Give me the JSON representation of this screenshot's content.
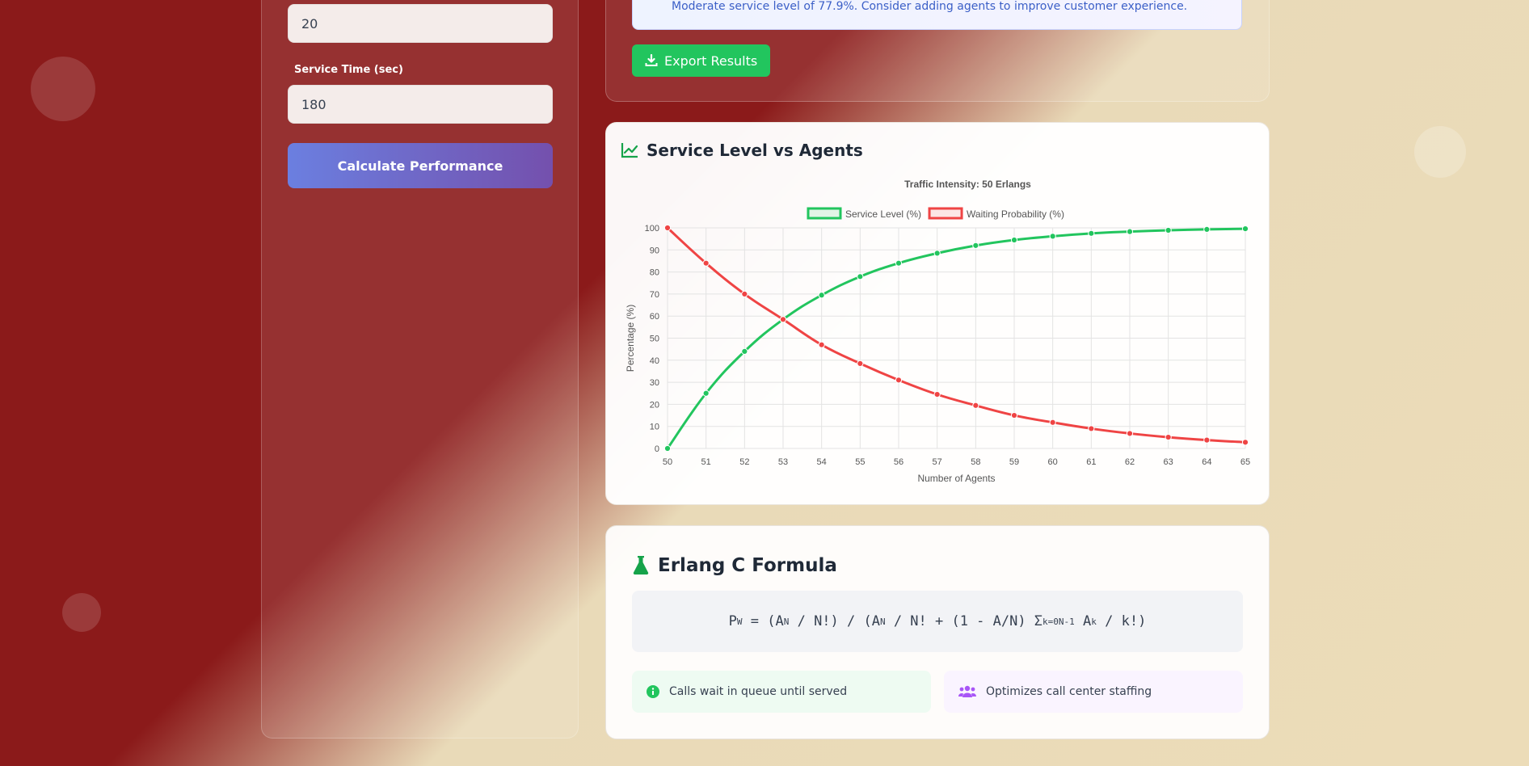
{
  "inputs": {
    "arrival_value": "20",
    "service_time_label": "Service Time (sec)",
    "service_time_value": "180",
    "calculate_label": "Calculate Performance"
  },
  "results": {
    "alert_text": "Moderate service level of 77.9%. Consider adding agents to improve customer experience.",
    "export_label": "Export Results"
  },
  "chart_card": {
    "title": "Service Level vs Agents",
    "icon": "chart-line-icon"
  },
  "chart_data": {
    "type": "line",
    "title": "Traffic Intensity: 50 Erlangs",
    "xlabel": "Number of Agents",
    "ylabel": "Percentage (%)",
    "x": [
      50,
      51,
      52,
      53,
      54,
      55,
      56,
      57,
      58,
      59,
      60,
      61,
      62,
      63,
      64,
      65
    ],
    "ylim": [
      0,
      100
    ],
    "yticks": [
      0,
      10,
      20,
      30,
      40,
      50,
      60,
      70,
      80,
      90,
      100
    ],
    "grid": true,
    "legend": "top-center",
    "series": [
      {
        "name": "Service Level (%)",
        "color": "#22c55e",
        "values": [
          0,
          25,
          44,
          58.5,
          69.5,
          77.9,
          84,
          88.5,
          92,
          94.5,
          96.2,
          97.5,
          98.3,
          98.9,
          99.3,
          99.6
        ]
      },
      {
        "name": "Waiting Probability (%)",
        "color": "#ef4444",
        "values": [
          100,
          84,
          70,
          58.5,
          47,
          38.5,
          31,
          24.5,
          19.5,
          15,
          11.8,
          9,
          6.8,
          5.1,
          3.8,
          2.8
        ]
      }
    ]
  },
  "formula_card": {
    "title": "Erlang C Formula",
    "icon": "flask-icon",
    "chip1": "Calls wait in queue until served",
    "chip2": "Optimizes call center staffing"
  },
  "colors": {
    "accent_green": "#22c55e",
    "accent_red": "#ef4444",
    "button_purple": "#6b7fe0",
    "background_red": "#8b1a1a"
  }
}
